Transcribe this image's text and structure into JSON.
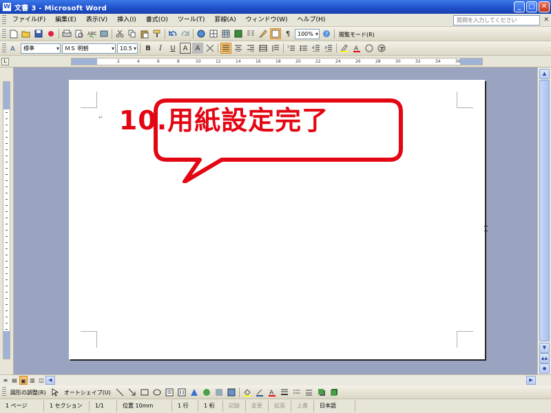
{
  "window": {
    "title": "文書 3 - Microsoft Word",
    "minimize": "_",
    "maximize": "□",
    "close": "✕"
  },
  "menu": {
    "items": [
      "ファイル(F)",
      "編集(E)",
      "表示(V)",
      "挿入(I)",
      "書式(O)",
      "ツール(T)",
      "罫線(A)",
      "ウィンドウ(W)",
      "ヘルプ(H)"
    ],
    "help_placeholder": "質問を入力してください",
    "doc_close": "✕"
  },
  "standard_toolbar": {
    "zoom": "100%",
    "reading_mode": "閲覧モード(R)"
  },
  "format_toolbar": {
    "style": "標準",
    "font": "ＭＳ 明朝",
    "size": "10.5",
    "bold": "B",
    "italic": "I",
    "underline": "U",
    "char_border": "A",
    "char_shading": "A"
  },
  "ruler": {
    "corner": "L",
    "ticks": [
      "2",
      "4",
      "6",
      "8",
      "10",
      "12",
      "14",
      "16",
      "18",
      "20",
      "22",
      "24",
      "26",
      "28",
      "30",
      "32",
      "34",
      "36"
    ]
  },
  "document": {
    "paragraph_mark": "↵",
    "callout_text": "10.用紙設定完了",
    "callout_color": "#e30613"
  },
  "view_buttons": [
    "≡",
    "▤",
    "▣",
    "▥",
    "◫"
  ],
  "drawing_toolbar": {
    "draw_menu": "図形の調整(R)",
    "autoshapes": "オートシェイプ(U)"
  },
  "status": {
    "page": "1 ページ",
    "section": "1 セクション",
    "page_of": "1/1",
    "position": "位置 10mm",
    "line": "1 行",
    "column": "1 桁",
    "rec": "記録",
    "trk": "変更",
    "ext": "拡張",
    "ovr": "上書",
    "language": "日本語"
  },
  "colors": {
    "titlebar": "#2a5bd7",
    "workspace": "#9aa3c0",
    "accent": "#e30613"
  }
}
